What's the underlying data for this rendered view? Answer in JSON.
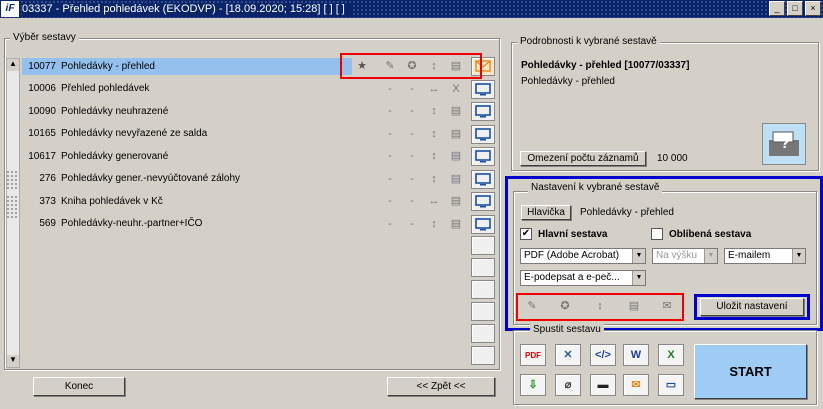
{
  "window": {
    "logo": "iF",
    "title": "03337 - Přehled pohledávek (EKODVP) - [18.09.2020; 15:28] [ ] [ ]",
    "min": "_",
    "max": "□",
    "close": "×"
  },
  "left": {
    "group_label": "Výběr sestavy",
    "rows": [
      {
        "code": "10077",
        "name": "Pohledávky - přehled"
      },
      {
        "code": "10006",
        "name": "Přehled pohledávek"
      },
      {
        "code": "10090",
        "name": "Pohledávky neuhrazené"
      },
      {
        "code": "10165",
        "name": "Pohledávky nevyřazené ze salda"
      },
      {
        "code": "10617",
        "name": "Pohledávky generované"
      },
      {
        "code": "276",
        "name": "Pohledávky gener.-nevyúčtované zálohy"
      },
      {
        "code": "373",
        "name": "Kniha pohledávek v Kč"
      },
      {
        "code": "569",
        "name": "Pohledávky-neuhr.-partner+IČO"
      }
    ],
    "dash": "-",
    "end_button": "Konec",
    "back_button": "<< Zpět <<"
  },
  "details": {
    "group_label": "Podrobnosti k vybrané sestavě",
    "title": "Pohledávky - přehled [10077/03337]",
    "subtitle": "Pohledávky - přehled",
    "limit_button": "Omezení počtu záznamů",
    "limit_value": "10 000"
  },
  "settings": {
    "group_label": "Nastavení k vybrané sestavě",
    "header_button": "Hlavička",
    "header_value": "Pohledávky - přehled",
    "main_label": "Hlavní sestava",
    "main_checked": "✔",
    "fav_label": "Oblíbená sestava",
    "format": "PDF (Adobe Acrobat)",
    "orientation": "Na výšku",
    "delivery": "E-mailem",
    "sign": "E-podepsat a e-peč...",
    "save_button": "Uložit nastavení"
  },
  "run": {
    "group_label": "Spustit sestavu",
    "start_button": "START",
    "icon_pdf": "PDF",
    "icon_xls": "X",
    "icon_doc": "W",
    "icon_code": "</>"
  },
  "colors": {
    "selection": "#94c0ee",
    "highlight_red": "#e00000",
    "highlight_blue": "#0000cc",
    "start_bg": "#9fccf4"
  }
}
